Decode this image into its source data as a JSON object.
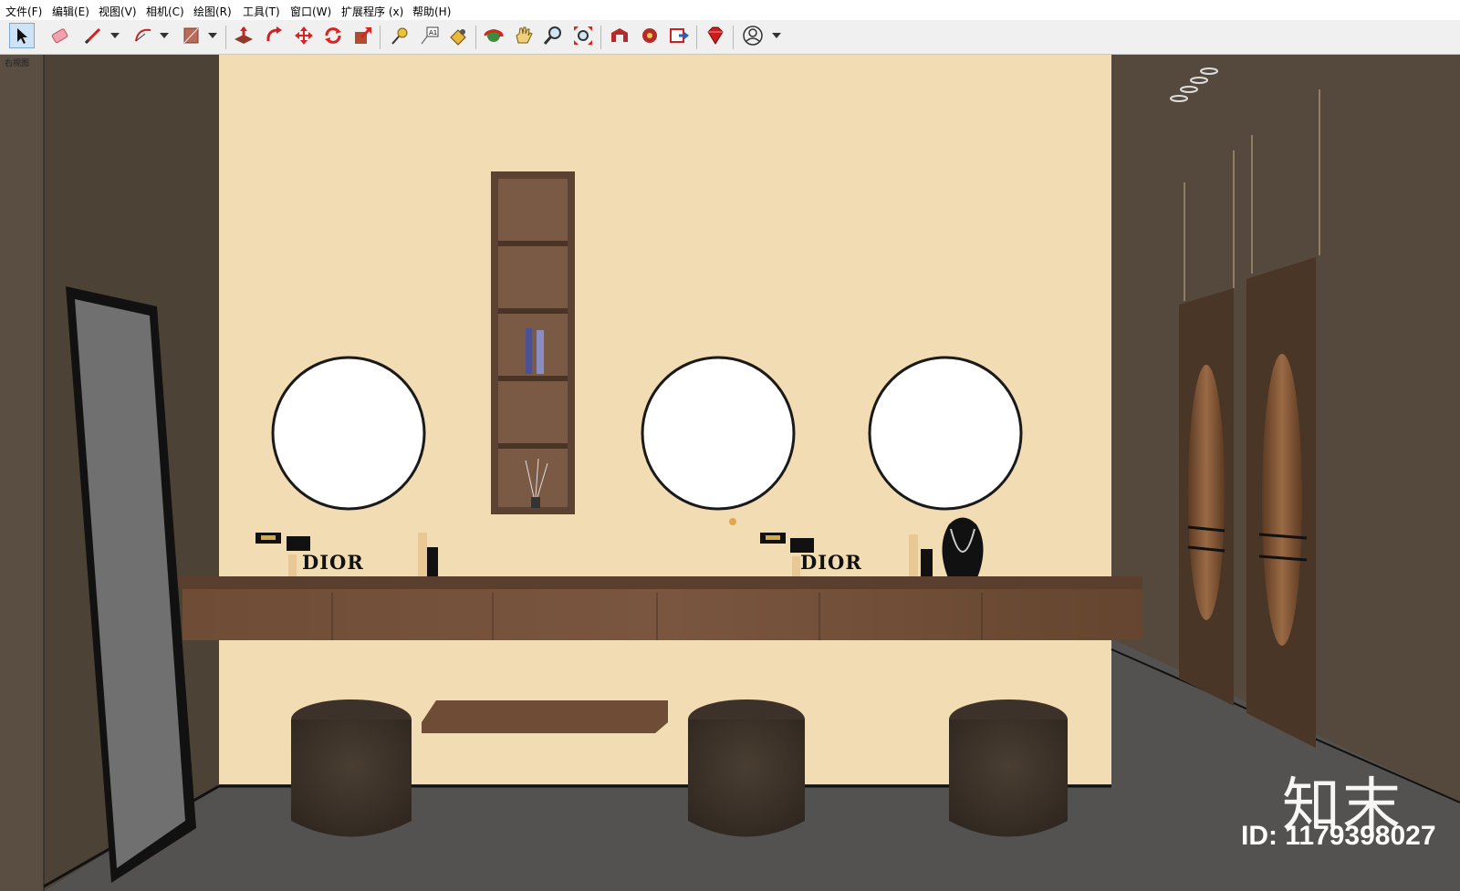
{
  "menubar": {
    "items": [
      "文件(F)",
      "编辑(E)",
      "视图(V)",
      "相机(C)",
      "绘图(R)",
      "工具(T)",
      "窗口(W)",
      "扩展程序 (x)",
      "帮助(H)"
    ]
  },
  "toolbar": {
    "icons": [
      "select-icon",
      "eraser-icon",
      "pencil-icon",
      "arc-icon",
      "paint-bucket-icon",
      "push-pull-icon",
      "follow-me-icon",
      "move-icon",
      "rotate-icon",
      "scale-icon",
      "tape-measure-icon",
      "text-label-icon",
      "paint-icon",
      "orbit-icon",
      "pan-icon",
      "zoom-icon",
      "zoom-extents-icon",
      "warehouse-icon",
      "extension-warehouse-icon",
      "layout-send-icon",
      "ruby-icon",
      "account-icon"
    ]
  },
  "viewport": {
    "view_label": "右视图",
    "scene_text_1": "DIOR",
    "scene_text_2": "DIOR"
  },
  "watermark": {
    "brand": "知末",
    "id_text": "ID: 1179398027"
  },
  "colors": {
    "wall": "#f1dcb4",
    "side_wall": "#55493d",
    "floor": "#545250",
    "wood": "#6a4a35",
    "stool": "#3a3026"
  }
}
